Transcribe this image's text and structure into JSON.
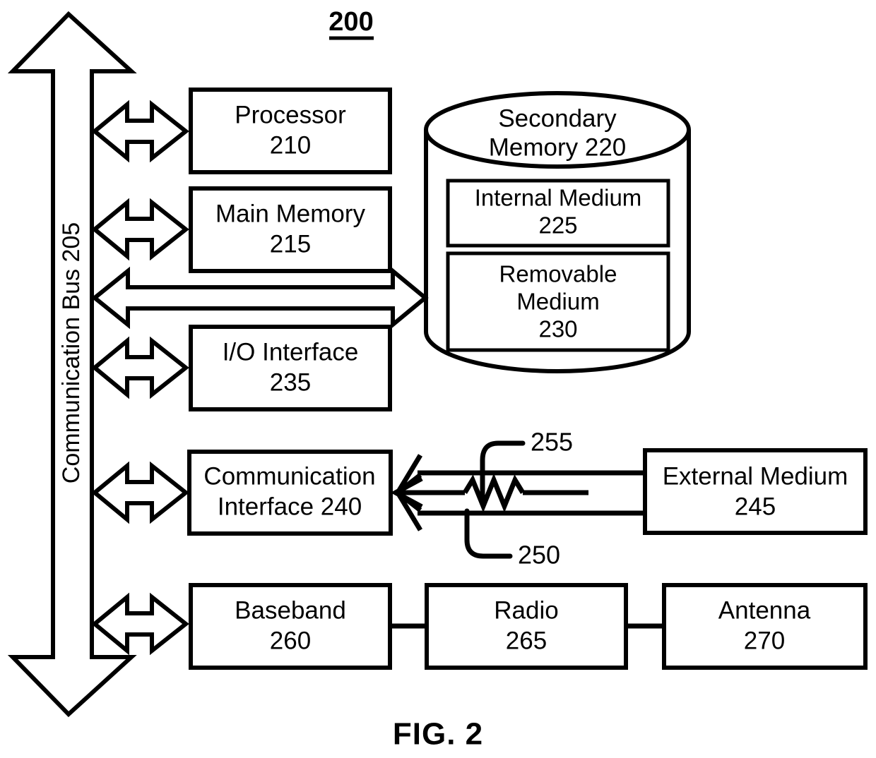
{
  "figure": {
    "number_label": "200",
    "caption": "FIG. 2"
  },
  "bus": {
    "label": "Communication Bus 205"
  },
  "blocks": {
    "processor": {
      "line1": "Processor",
      "line2": "210"
    },
    "main_memory": {
      "line1": "Main Memory",
      "line2": "215"
    },
    "io_interface": {
      "line1": "I/O Interface",
      "line2": "235"
    },
    "communication_interface": {
      "line1": "Communication",
      "line2": "Interface 240"
    },
    "baseband": {
      "line1": "Baseband",
      "line2": "260"
    },
    "radio": {
      "line1": "Radio",
      "line2": "265"
    },
    "antenna": {
      "line1": "Antenna",
      "line2": "270"
    },
    "external_medium": {
      "line1": "External Medium",
      "line2": "245"
    },
    "secondary_memory": {
      "line1": "Secondary",
      "line2": "Memory 220"
    },
    "internal_medium": {
      "line1": "Internal Medium",
      "line2": "225"
    },
    "removable_medium": {
      "line1": "Removable",
      "line2": "Medium",
      "line3": "230"
    }
  },
  "callouts": {
    "wireless_link": "255",
    "wired_link": "250"
  },
  "colors": {
    "line": "#000000",
    "fill": "#ffffff"
  }
}
